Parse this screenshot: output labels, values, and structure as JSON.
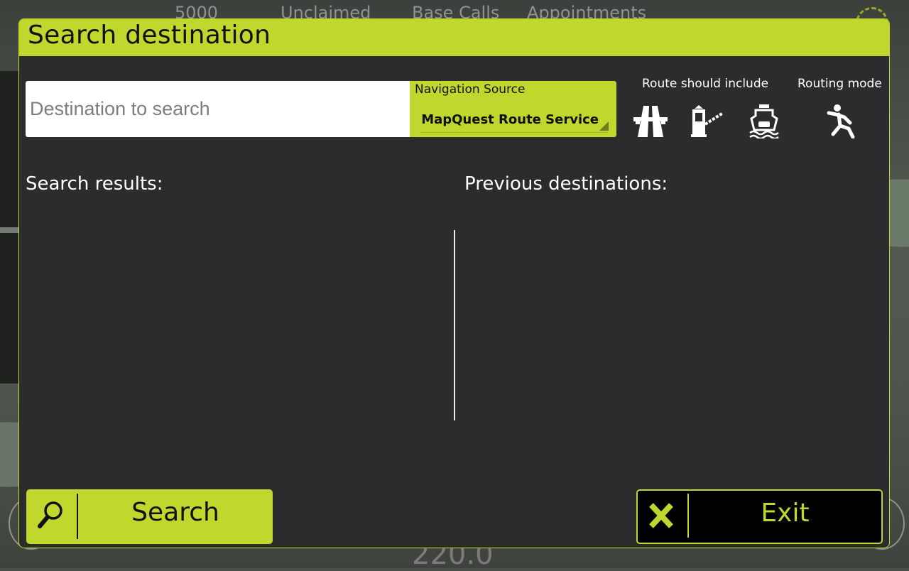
{
  "background": {
    "topbar": [
      "5000",
      "Unclaimed",
      "Base Calls",
      "Appointments"
    ],
    "speed_readout": "220.0"
  },
  "dialog": {
    "title": "Search destination",
    "search_input": {
      "value": "",
      "placeholder": "Destination to search"
    },
    "navigation_source": {
      "label": "Navigation Source",
      "selected": "MapQuest Route Service"
    },
    "route_include": {
      "label": "Route should include",
      "options": [
        {
          "name": "highway",
          "icon": "highway-icon"
        },
        {
          "name": "toll",
          "icon": "toll-booth-icon"
        },
        {
          "name": "ferry",
          "icon": "ferry-icon"
        }
      ]
    },
    "routing_mode": {
      "label": "Routing mode",
      "selected": "pedestrian",
      "icon": "pedestrian-icon"
    },
    "search_results_title": "Search results:",
    "search_results": [],
    "previous_destinations_title": "Previous destinations:",
    "previous_destinations": [],
    "search_button": "Search",
    "exit_button": "Exit"
  },
  "colors": {
    "accent": "#c0d82e",
    "panel": "#2c2c2e",
    "text": "#ffffff"
  }
}
